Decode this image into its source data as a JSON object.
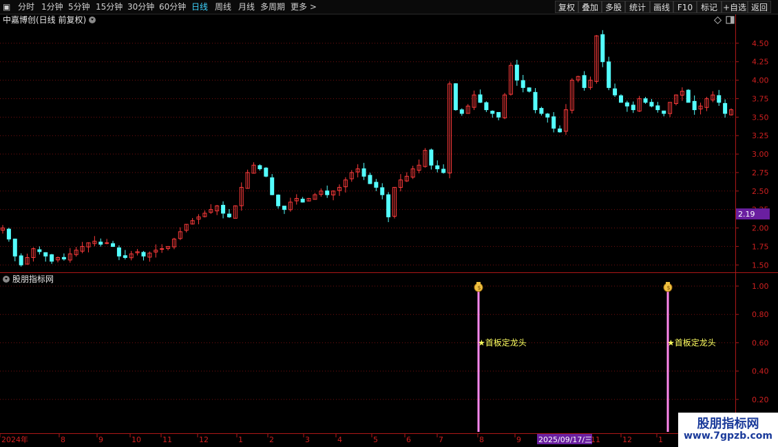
{
  "toolbar": {
    "left_items": [
      "分时",
      "1分钟",
      "5分钟",
      "15分钟",
      "30分钟",
      "60分钟",
      "日线",
      "周线",
      "月线",
      "多周期",
      "更多 >"
    ],
    "active_item": "日线",
    "right_items": [
      "复权",
      "叠加",
      "多股",
      "统计",
      "画线",
      "F10",
      "标记",
      "+自选",
      "返回"
    ]
  },
  "chart_title": "中嘉博创(日线 前复权)",
  "price_axis": [
    "4.50",
    "4.25",
    "4.00",
    "3.75",
    "3.50",
    "3.25",
    "3.00",
    "2.75",
    "2.50",
    "2.25",
    "2.00",
    "1.75",
    "1.50"
  ],
  "price_label": "2.19",
  "indicator": {
    "name": "股朋指标网",
    "axis": [
      "1.00",
      "0.80",
      "0.60",
      "0.40",
      "0.20"
    ],
    "signal_text": "★首板定龙头"
  },
  "date_axis": [
    "2024年",
    "8",
    "9",
    "10",
    "11",
    "12",
    "1",
    "2",
    "3",
    "4",
    "5",
    "6",
    "7",
    "8",
    "9",
    "10",
    "11",
    "12",
    "1"
  ],
  "cursor_date": "2025/09/17/三",
  "watermark": {
    "title": "股朋指标网",
    "url": "www.7gpzb.com"
  },
  "colors": {
    "up": "#ff3b3b",
    "down": "#54ffff",
    "signal": "#ff88ee",
    "grid": "#7a1010",
    "price_label_bg": "#6a1fa0",
    "active_tab": "#3fd4ff"
  },
  "chart_data": {
    "type": "candlestick",
    "title": "中嘉博创(日线 前复权)",
    "ylim": [
      1.4,
      4.75
    ],
    "x_labels": [
      "2024年",
      "8",
      "9",
      "10",
      "11",
      "12",
      "1",
      "2",
      "3",
      "4",
      "5",
      "6",
      "7",
      "8",
      "9",
      "10",
      "11",
      "12",
      "1"
    ],
    "close_trend": [
      2.0,
      1.85,
      1.62,
      1.5,
      1.6,
      1.72,
      1.68,
      1.62,
      1.55,
      1.6,
      1.58,
      1.65,
      1.7,
      1.75,
      1.8,
      1.82,
      1.78,
      1.8,
      1.75,
      1.62,
      1.6,
      1.65,
      1.68,
      1.62,
      1.66,
      1.7,
      1.72,
      1.75,
      1.85,
      1.95,
      2.05,
      2.1,
      2.15,
      2.2,
      2.25,
      2.3,
      2.2,
      2.15,
      2.3,
      2.55,
      2.75,
      2.85,
      2.8,
      2.7,
      2.45,
      2.3,
      2.25,
      2.35,
      2.4,
      2.35,
      2.4,
      2.45,
      2.5,
      2.45,
      2.5,
      2.55,
      2.65,
      2.75,
      2.8,
      2.7,
      2.6,
      2.55,
      2.45,
      2.15,
      2.55,
      2.65,
      2.7,
      2.8,
      2.85,
      3.05,
      2.85,
      2.8,
      2.75,
      3.95,
      3.6,
      3.55,
      3.65,
      3.8,
      3.7,
      3.6,
      3.55,
      3.5,
      3.8,
      4.2,
      4.0,
      3.9,
      3.85,
      3.6,
      3.55,
      3.5,
      3.35,
      3.3,
      3.6,
      4.0,
      4.05,
      3.9,
      4.0,
      4.6,
      4.25,
      3.9,
      3.8,
      3.7,
      3.65,
      3.6,
      3.75,
      3.7,
      3.65,
      3.6,
      3.55,
      3.7,
      3.8,
      3.85,
      3.7,
      3.6,
      3.65,
      3.75,
      3.8,
      3.7,
      3.55,
      3.6
    ],
    "indicator_signals": [
      {
        "date": "8",
        "value": 1.0,
        "label": "★首板定龙头"
      },
      {
        "date": "1",
        "value": 1.0,
        "label": "★首板定龙头"
      }
    ],
    "indicator_ylim": [
      0,
      1.0
    ]
  }
}
